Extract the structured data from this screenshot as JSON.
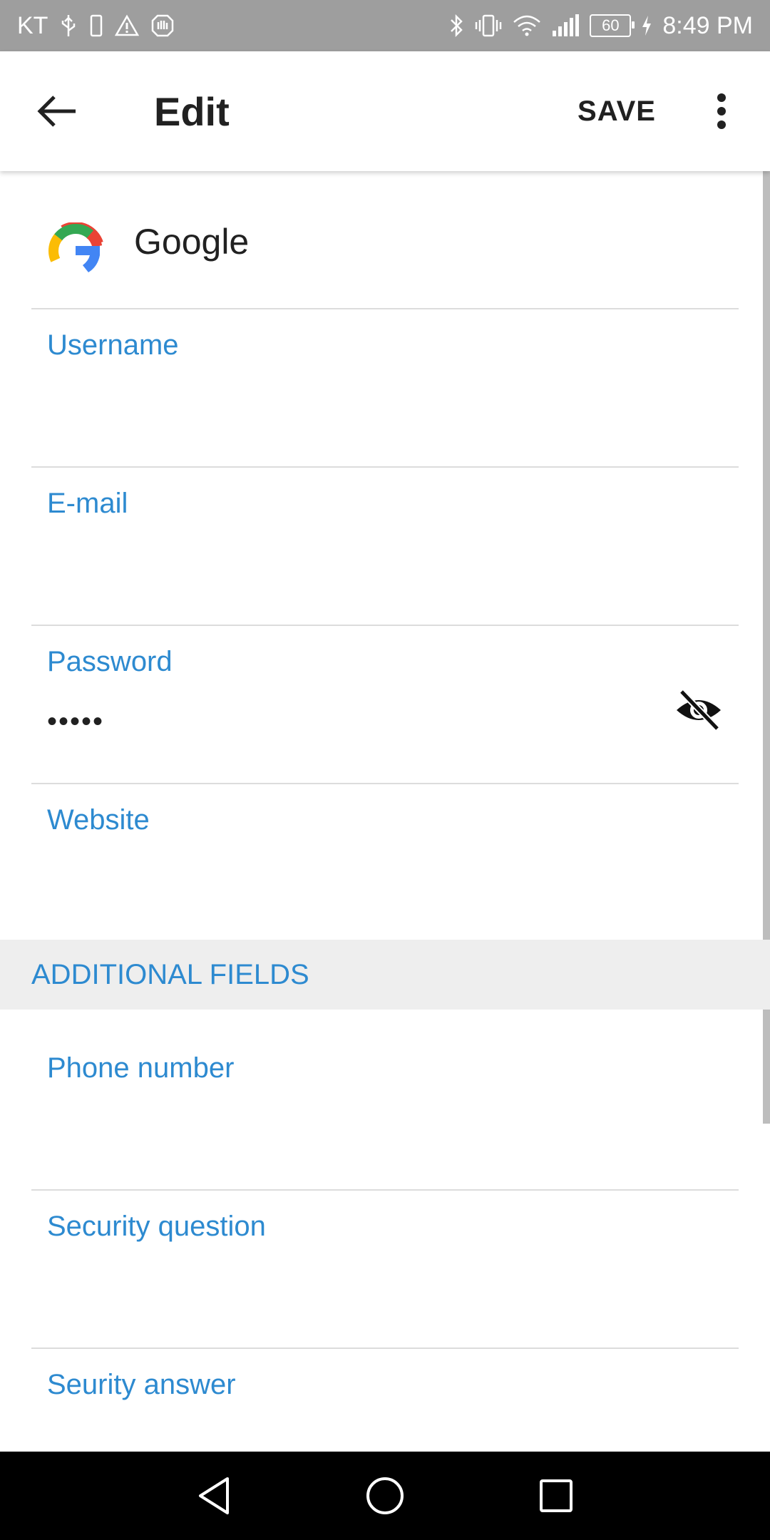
{
  "status_bar": {
    "carrier": "KT",
    "battery_level": "60",
    "time": "8:49 PM"
  },
  "app_bar": {
    "title": "Edit",
    "save_label": "SAVE"
  },
  "service": {
    "name": "Google"
  },
  "fields": {
    "username": {
      "label": "Username",
      "value": ""
    },
    "email": {
      "label": "E-mail",
      "value": ""
    },
    "password": {
      "label": "Password",
      "value": "•••••"
    },
    "website": {
      "label": "Website",
      "value": ""
    }
  },
  "additional": {
    "header": "ADDITIONAL FIELDS",
    "phone": {
      "label": "Phone number",
      "value": ""
    },
    "security_question": {
      "label": "Security question",
      "value": ""
    },
    "security_answer": {
      "label": "Seurity answer",
      "value": ""
    }
  },
  "colors": {
    "accent_label": "#2d8ad0",
    "status_bar": "#9e9e9e",
    "section_header_bg": "#eeeeee",
    "nav_bar": "#000000"
  },
  "icons": {
    "back": "arrow-left-icon",
    "more": "more-vertical-icon",
    "visibility": "visibility-off-icon",
    "nav_back": "triangle-back-icon",
    "nav_home": "circle-home-icon",
    "nav_recents": "square-recents-icon"
  }
}
